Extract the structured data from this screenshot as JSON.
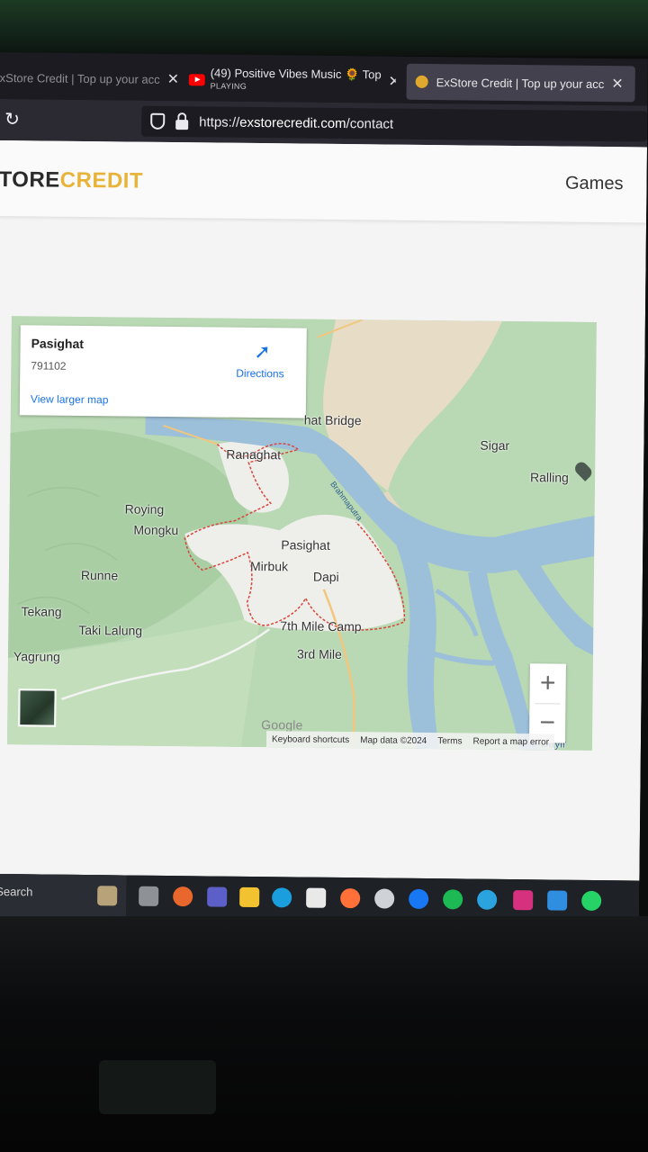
{
  "browser": {
    "tabs": [
      {
        "label": "xStore Credit | Top up your acc",
        "active": false
      },
      {
        "label": "(49) Positive Vibes Music 🌻 Top",
        "sublabel": "PLAYING",
        "active": false
      },
      {
        "label": "ExStore Credit | Top up your acc",
        "active": true
      }
    ],
    "url_prefix": "https://",
    "url_host": "exstorecredit.com",
    "url_path": "/contact"
  },
  "site": {
    "logo_part1": "TORE",
    "logo_part2": "CREDIT",
    "nav_games": "Games",
    "colors": {
      "accent": "#e8b339"
    }
  },
  "map": {
    "info": {
      "title": "Pasighat",
      "postcode": "791102",
      "directions": "Directions",
      "larger_map": "View larger map"
    },
    "places": {
      "bridge": "hat Bridge",
      "sigar": "Sigar",
      "ralling": "Ralling",
      "ranaghat": "Ranaghat",
      "river": "Brahmaputra",
      "roying": "Roying",
      "mongku": "Mongku",
      "pasighat": "Pasighat",
      "runne": "Runne",
      "mirbuk": "Mirbuk",
      "dapi": "Dapi",
      "tekang": "Tekang",
      "seventh_mile": "7th Mile Camp",
      "taki_lalung": "Taki Lalung",
      "third_mile": "3rd Mile",
      "yagrung": "Yagrung",
      "dayir": "Dayir"
    },
    "zoom_in": "+",
    "zoom_out": "−",
    "google": "Google",
    "attribution": {
      "shortcuts": "Keyboard shortcuts",
      "data": "Map data ©2024",
      "terms": "Terms",
      "report": "Report a map error"
    }
  },
  "taskbar": {
    "search": "Search",
    "icons": [
      "widget-icon",
      "task-view-icon",
      "firefox-badge-icon",
      "teams-icon",
      "file-explorer-icon",
      "edge-icon",
      "store-icon",
      "firefox-icon",
      "chrome-icon",
      "facebook-icon",
      "spotify-icon",
      "telegram-icon",
      "instagram-icon",
      "vscode-icon",
      "whatsapp-icon"
    ]
  }
}
